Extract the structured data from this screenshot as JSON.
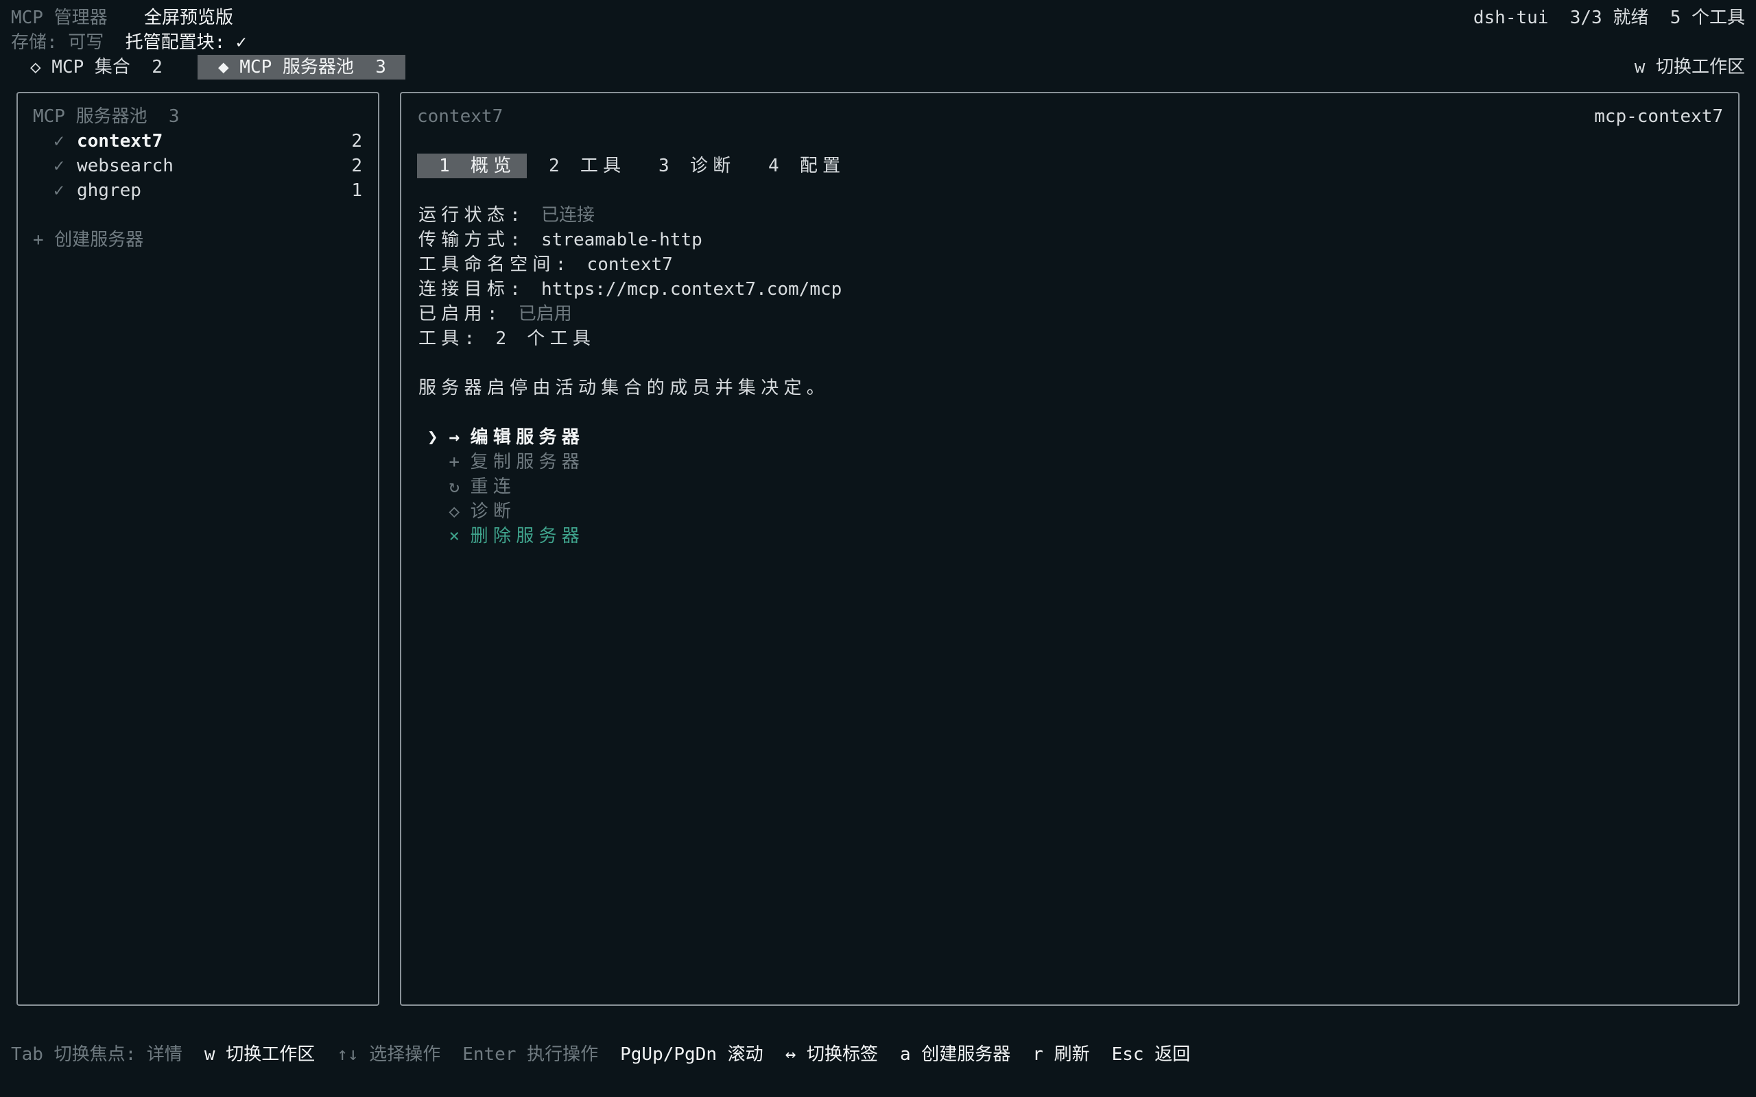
{
  "app": {
    "title": "MCP 管理器",
    "mode": "全屏预览版",
    "env": "dsh-tui",
    "ready": "3/3 就绪",
    "tools_count": "5 个工具",
    "storage_label": "存储: 可写",
    "managed_label": "托管配置块: ✓"
  },
  "tabs": {
    "sets": "◇ MCP 集合  2",
    "pool": "◆ MCP 服务器池  3",
    "switch_workspace": "w 切换工作区"
  },
  "pool": {
    "title": "MCP 服务器池  3",
    "servers": [
      {
        "check": "✓",
        "name": "context7",
        "count": "2"
      },
      {
        "check": "✓",
        "name": "websearch",
        "count": "2"
      },
      {
        "check": "✓",
        "name": "ghgrep",
        "count": "1"
      }
    ],
    "create": "+ 创建服务器"
  },
  "detail": {
    "title": "context7",
    "id": "mcp-context7",
    "tabs": [
      "1 概览",
      "2 工具",
      "3 诊断",
      "4 配置"
    ],
    "fields": [
      {
        "label": "运行状态: ",
        "value": "已连接"
      },
      {
        "label": "传输方式: ",
        "value": "streamable-http"
      },
      {
        "label": "工具命名空间: ",
        "value": "context7"
      },
      {
        "label": "连接目标: ",
        "value": "https://mcp.context7.com/mcp"
      },
      {
        "label": "已启用: ",
        "value": "已启用"
      },
      {
        "label": "工具: ",
        "value": "2 个工具"
      }
    ],
    "note": "服务器启停由活动集合的成员并集决定。",
    "actions": [
      {
        "icon": "❯ →",
        "label": "编辑服务器"
      },
      {
        "icon": "+",
        "label": "复制服务器"
      },
      {
        "icon": "↻",
        "label": "重连"
      },
      {
        "icon": "◇",
        "label": "诊断"
      },
      {
        "icon": "×",
        "label": "删除服务器"
      }
    ]
  },
  "footer": {
    "tab_focus": "Tab 切换焦点: 详情",
    "workspace": "w 切换工作区",
    "select": "↑↓ 选择操作",
    "enter": "Enter 执行操作",
    "scroll": "PgUp/PgDn 滚动",
    "switch_tab": "↔ 切换标签",
    "create": "a 创建服务器",
    "refresh": "r 刷新",
    "back": "Esc 返回"
  },
  "colors": {
    "background": "#0b1419",
    "selected_bg": "#5b6064",
    "danger": "#3fa38c",
    "dim": "#6f7a80"
  }
}
